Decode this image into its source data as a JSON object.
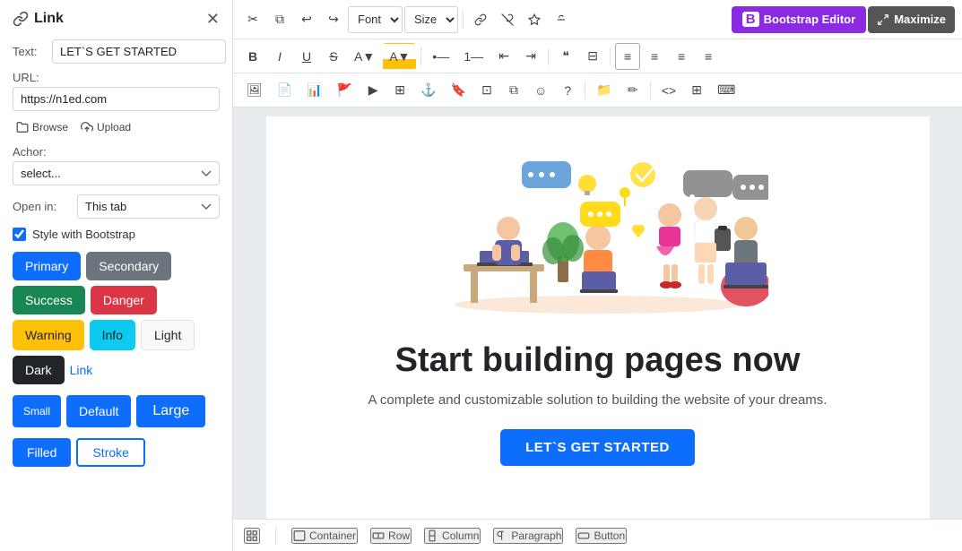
{
  "panel": {
    "title": "Link",
    "text_label": "Text:",
    "text_value": "LET`S GET STARTED",
    "url_label": "URL:",
    "url_value": "https://n1ed.com|",
    "browse_label": "Browse",
    "upload_label": "Upload",
    "anchor_label": "Achor:",
    "anchor_placeholder": "select...",
    "open_in_label": "Open in:",
    "open_in_value": "This tab",
    "style_check_label": "Style with Bootstrap",
    "buttons": {
      "primary": "Primary",
      "secondary": "Secondary",
      "success": "Success",
      "danger": "Danger",
      "warning": "Warning",
      "info": "Info",
      "light": "Light",
      "dark": "Dark",
      "link": "Link"
    },
    "sizes": {
      "small": "Small",
      "default": "Default",
      "large": "Large"
    },
    "styles": {
      "filled": "Filled",
      "stroke": "Stroke"
    }
  },
  "toolbar": {
    "font_select": "Font",
    "size_select": "Size",
    "bootstrap_editor": "Bootstrap Editor",
    "maximize": "Maximize"
  },
  "editor": {
    "hero_title": "Start building pages now",
    "hero_subtitle": "A complete and customizable solution to building the website of your dreams.",
    "cta_button": "LET`S GET STARTED"
  },
  "bottom_bar": {
    "items": [
      "Container",
      "Row",
      "Column",
      "Paragraph",
      "Button"
    ]
  }
}
